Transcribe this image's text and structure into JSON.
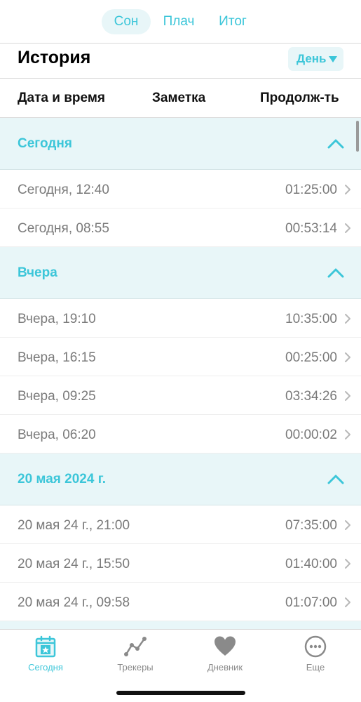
{
  "top_tabs": [
    {
      "label": "Сон",
      "active": true
    },
    {
      "label": "Плач",
      "active": false
    },
    {
      "label": "Итог",
      "active": false
    }
  ],
  "history": {
    "title": "История",
    "period": "День"
  },
  "columns": {
    "datetime": "Дата и время",
    "note": "Заметка",
    "duration": "Продолж-ть"
  },
  "sections": [
    {
      "title": "Сегодня",
      "rows": [
        {
          "label": "Сегодня, 12:40",
          "duration": "01:25:00"
        },
        {
          "label": "Сегодня, 08:55",
          "duration": "00:53:14"
        }
      ]
    },
    {
      "title": "Вчера",
      "rows": [
        {
          "label": "Вчера, 19:10",
          "duration": "10:35:00"
        },
        {
          "label": "Вчера, 16:15",
          "duration": "00:25:00"
        },
        {
          "label": "Вчера, 09:25",
          "duration": "03:34:26"
        },
        {
          "label": "Вчера, 06:20",
          "duration": "00:00:02"
        }
      ]
    },
    {
      "title": "20 мая 2024 г.",
      "rows": [
        {
          "label": "20 мая 24 г., 21:00",
          "duration": "07:35:00"
        },
        {
          "label": "20 мая 24 г., 15:50",
          "duration": "01:40:00"
        },
        {
          "label": "20 мая 24 г., 09:58",
          "duration": "01:07:00"
        }
      ]
    }
  ],
  "bottom_tabs": [
    {
      "label": "Сегодня",
      "icon": "calendar-star-icon",
      "active": true
    },
    {
      "label": "Трекеры",
      "icon": "chart-line-icon",
      "active": false
    },
    {
      "label": "Дневник",
      "icon": "heart-icon",
      "active": false
    },
    {
      "label": "Еще",
      "icon": "more-icon",
      "active": false
    }
  ],
  "colors": {
    "accent": "#3cc6d9",
    "section_bg": "#e8f6f8",
    "muted_text": "#7a7a7a"
  }
}
